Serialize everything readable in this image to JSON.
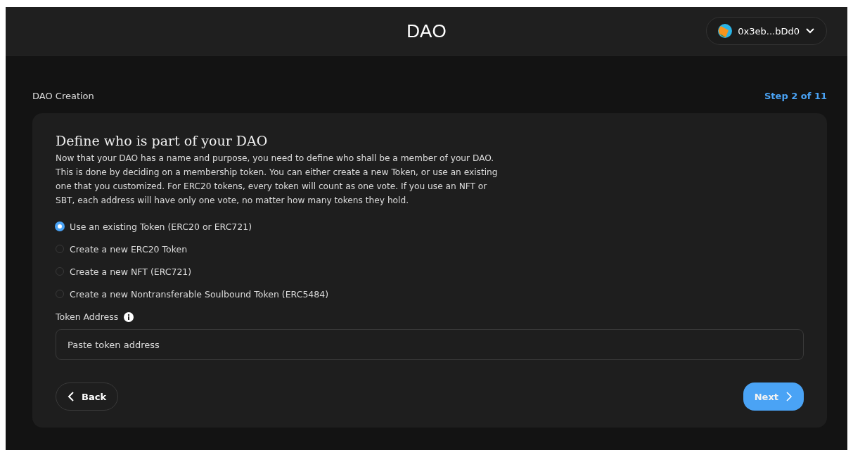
{
  "header": {
    "title": "DAO",
    "wallet": {
      "address": "0x3eb...bDd0"
    }
  },
  "breadcrumb": "DAO Creation",
  "step": "Step 2 of 11",
  "card": {
    "title": "Define who is part of your DAO",
    "description": "Now that your DAO has a name and purpose, you need to define who shall be a member of your DAO. This is done by deciding on a membership token. You can either create a new Token, or use an existing one that you customized. For ERC20 tokens, every token will count as one vote. If you use an NFT or SBT, each address will have only one vote, no matter how many tokens they hold.",
    "options": [
      {
        "label": "Use an existing Token (ERC20 or ERC721)",
        "selected": true
      },
      {
        "label": "Create a new ERC20 Token",
        "selected": false
      },
      {
        "label": "Create a new NFT (ERC721)",
        "selected": false
      },
      {
        "label": "Create a new Nontransferable Soulbound Token (ERC5484)",
        "selected": false
      }
    ],
    "field": {
      "label": "Token Address",
      "placeholder": "Paste token address"
    },
    "back": "Back",
    "next": "Next"
  }
}
